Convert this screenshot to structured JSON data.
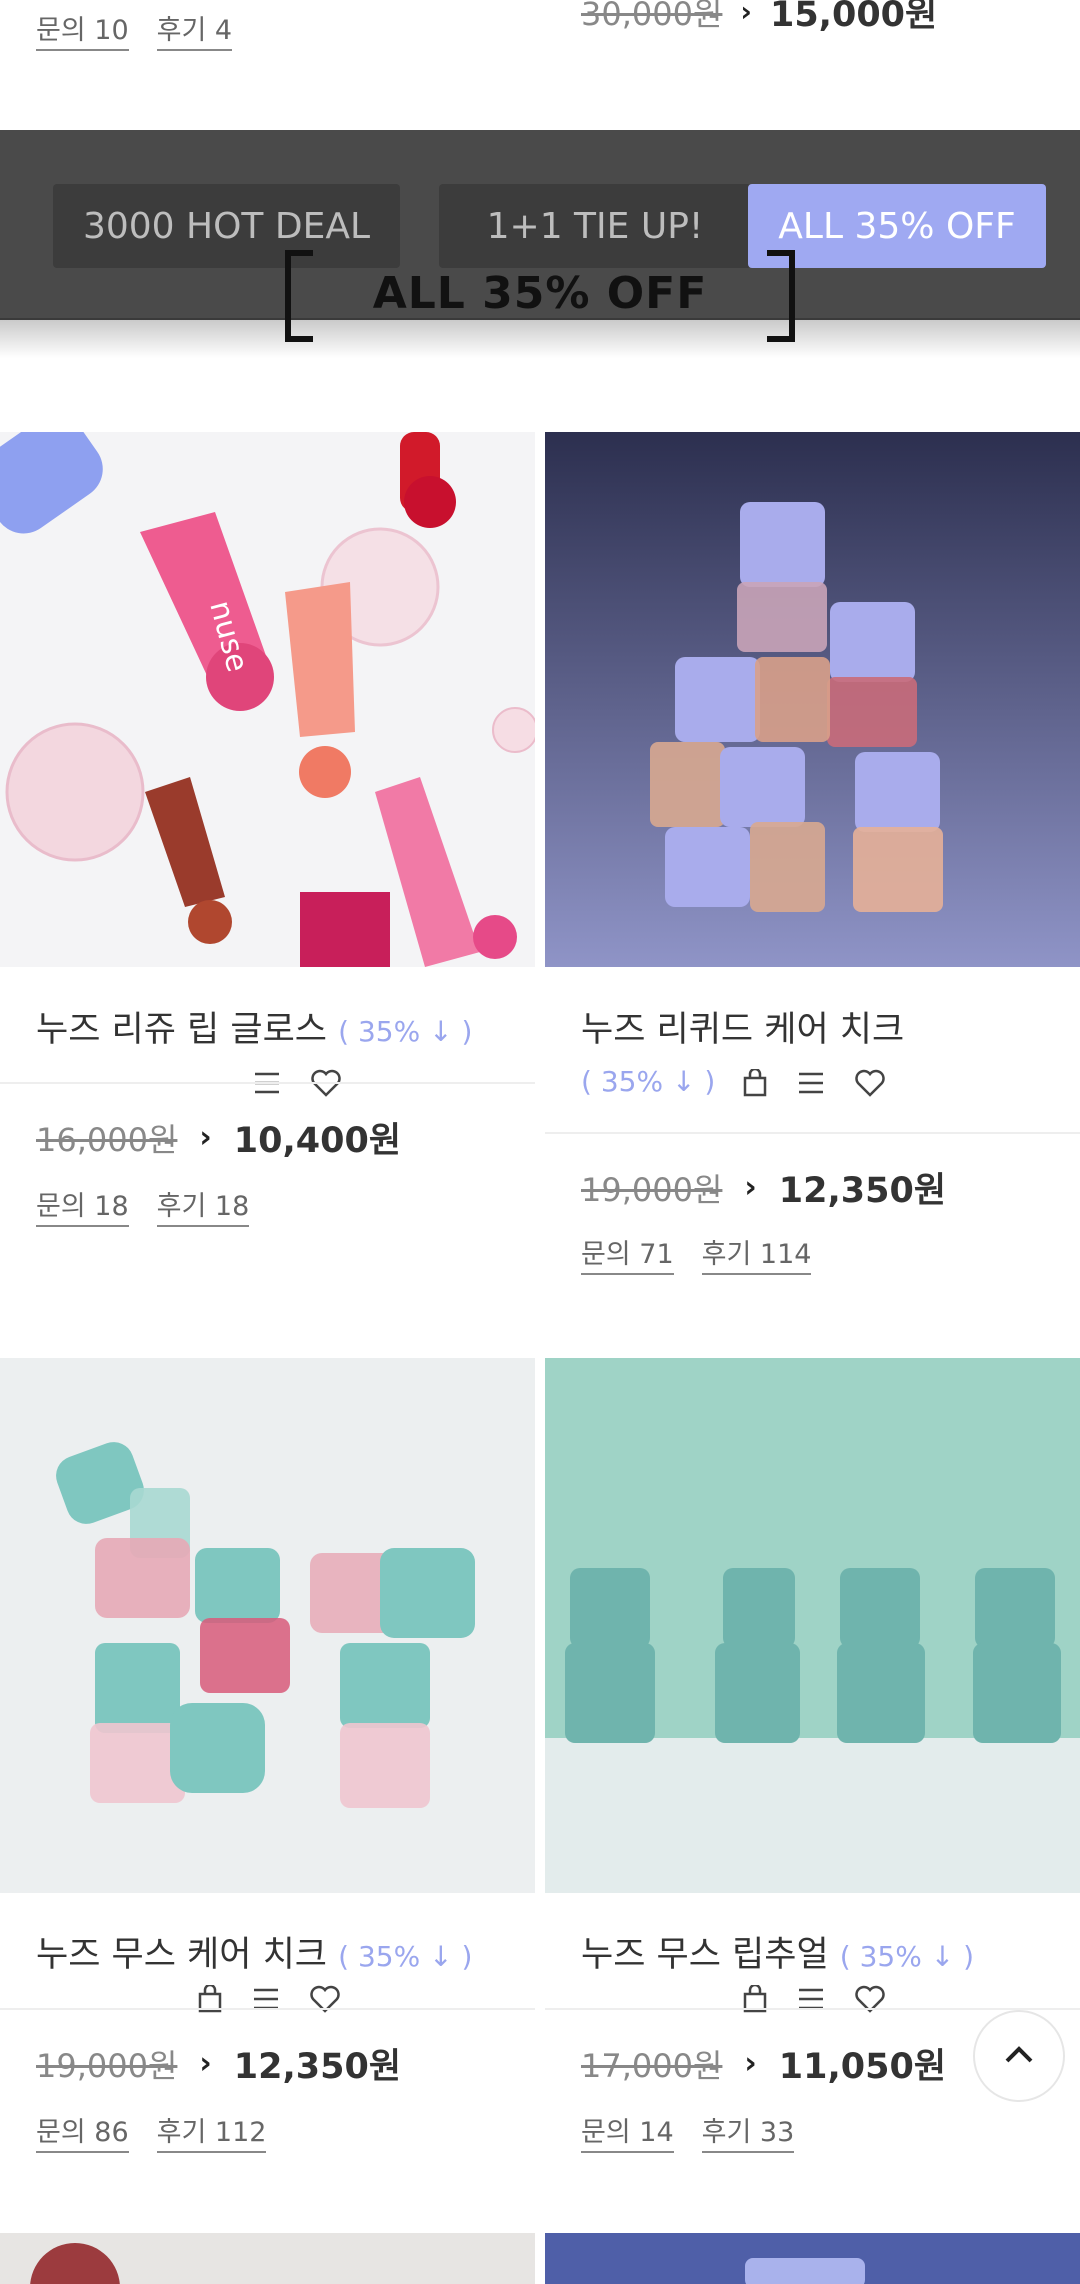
{
  "top_row": {
    "left_meta": {
      "inquiry": "문의 10",
      "review": "후기 4"
    },
    "right_price": {
      "old": "30,000원",
      "new": "15,000원"
    }
  },
  "tabs": [
    {
      "label": "3000 HOT DEAL",
      "active": false
    },
    {
      "label": "1+1 TIE UP!",
      "active": false
    },
    {
      "label": "ALL 35% OFF",
      "active": true
    }
  ],
  "section_title": "ALL 35% OFF",
  "products": [
    {
      "name": "누즈 리쥬 립 글로스",
      "discount": "( 35% ↓ )",
      "old_price": "16,000원",
      "new_price": "10,400원",
      "inquiry": "문의 18",
      "review": "후기 18"
    },
    {
      "name": "누즈 리퀴드 케어 치크",
      "discount": "( 35% ↓ )",
      "old_price": "19,000원",
      "new_price": "12,350원",
      "inquiry": "문의 71",
      "review": "후기 114"
    },
    {
      "name": "누즈 무스 케어 치크",
      "discount": "( 35% ↓ )",
      "old_price": "19,000원",
      "new_price": "12,350원",
      "inquiry": "문의 86",
      "review": "후기 112"
    },
    {
      "name": "누즈 무스 립추얼",
      "discount": "( 35% ↓ )",
      "old_price": "17,000원",
      "new_price": "11,050원",
      "inquiry": "문의 14",
      "review": "후기 33"
    }
  ],
  "brand_logo_text": "nuse",
  "icons": {
    "cart": "shopping-bag-icon",
    "list": "list-icon",
    "wishlist": "heart-icon",
    "scroll_top": "chevron-up-icon"
  },
  "colors": {
    "accent": "#9fa9f2",
    "discount": "#9aa6ee",
    "tabbar": "#4a4a4a"
  }
}
